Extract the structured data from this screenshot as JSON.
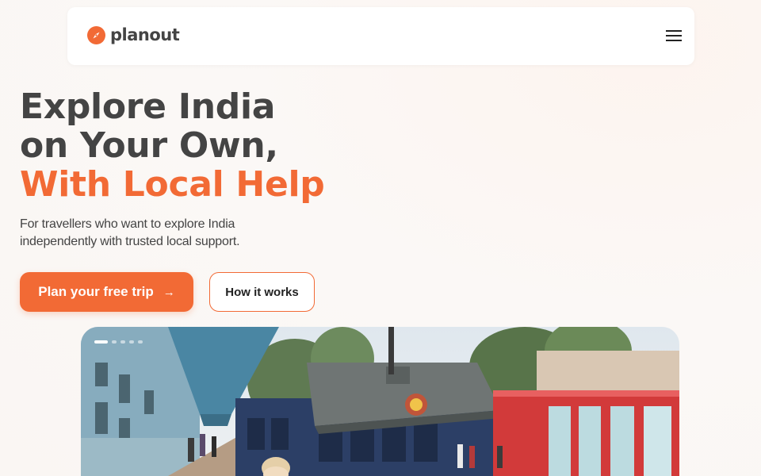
{
  "nav": {
    "brand": "planout",
    "menu_icon": "hamburger-menu-icon",
    "logo_icon": "compass-icon"
  },
  "hero": {
    "title_line1": "Explore India",
    "title_line2": "on Your Own,",
    "title_line3": "With Local Help",
    "subtitle": "For travellers who want to explore India independently with trusted local support.",
    "primary_cta": "Plan your free trip",
    "primary_cta_icon": "arrow-right-icon",
    "secondary_cta": "How it works"
  },
  "carousel": {
    "slide_count": 5,
    "active_slide": 1
  },
  "colors": {
    "accent": "#f26a35",
    "heading": "#444444"
  }
}
